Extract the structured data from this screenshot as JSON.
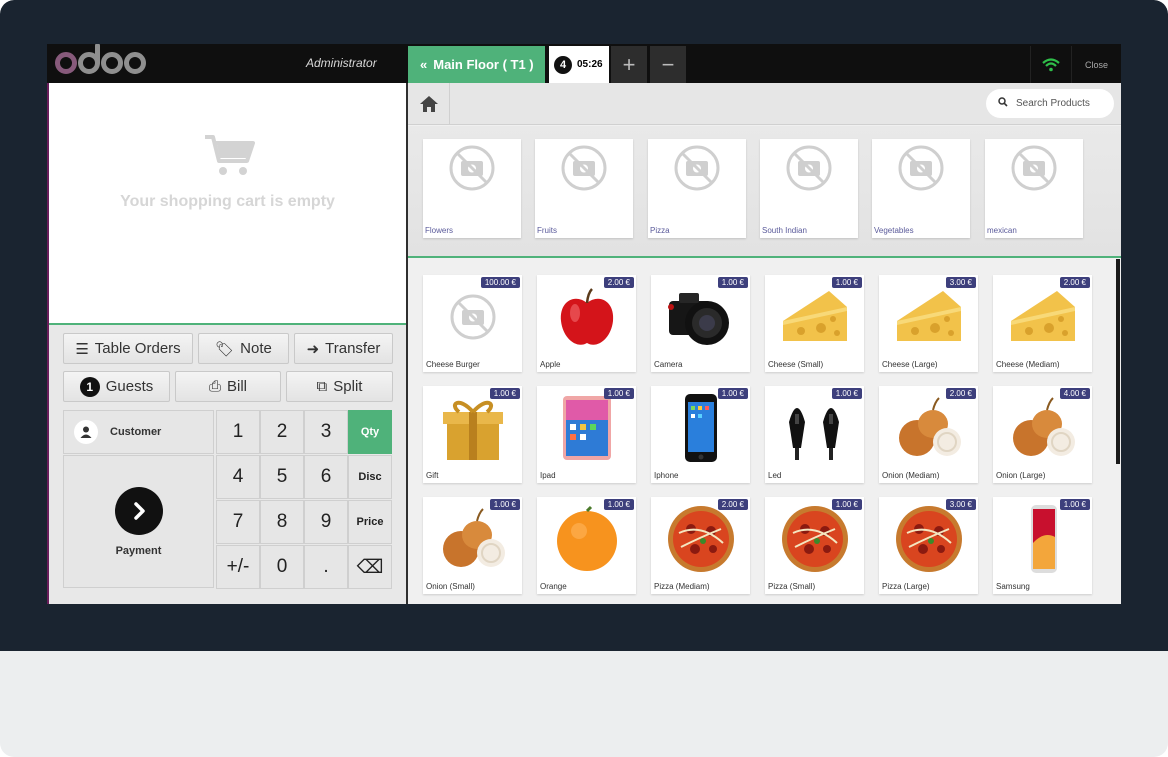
{
  "topbar": {
    "user": "Administrator",
    "floor_tab": "Main Floor ( T1 )",
    "order_number": "4",
    "order_time": "05:26",
    "add_label": "+",
    "remove_label": "−",
    "close_label": "Close"
  },
  "cart": {
    "empty_text": "Your shopping cart is empty"
  },
  "controls": {
    "table_orders": "Table Orders",
    "note": "Note",
    "transfer": "Transfer",
    "guests_count": "1",
    "guests": "Guests",
    "bill": "Bill",
    "split": "Split"
  },
  "numpad": {
    "customer": "Customer",
    "payment": "Payment",
    "keys": [
      "1",
      "2",
      "3",
      "Qty",
      "4",
      "5",
      "6",
      "Disc",
      "7",
      "8",
      "9",
      "Price",
      "+/-",
      "0",
      "."
    ],
    "backspace": "⌫"
  },
  "search": {
    "placeholder": "Search Products"
  },
  "categories": [
    "Flowers",
    "Fruits",
    "Pizza",
    "South Indian",
    "Vegetables",
    "mexican"
  ],
  "products": [
    {
      "name": "Cheese Burger",
      "price": "100.00 €",
      "image": "no-photo"
    },
    {
      "name": "Apple",
      "price": "2.00 €",
      "image": "apple"
    },
    {
      "name": "Camera",
      "price": "1.00 €",
      "image": "camera"
    },
    {
      "name": "Cheese (Small)",
      "price": "1.00 €",
      "image": "cheese"
    },
    {
      "name": "Cheese (Large)",
      "price": "3.00 €",
      "image": "cheese"
    },
    {
      "name": "Cheese (Mediam)",
      "price": "2.00 €",
      "image": "cheese"
    },
    {
      "name": "Gift",
      "price": "1.00 €",
      "image": "gift"
    },
    {
      "name": "Ipad",
      "price": "1.00 €",
      "image": "tablet"
    },
    {
      "name": "Iphone",
      "price": "1.00 €",
      "image": "phone"
    },
    {
      "name": "Led",
      "price": "1.00 €",
      "image": "led"
    },
    {
      "name": "Onion (Mediam)",
      "price": "2.00 €",
      "image": "onion"
    },
    {
      "name": "Onion (Large)",
      "price": "4.00 €",
      "image": "onion"
    },
    {
      "name": "Onion (Small)",
      "price": "1.00 €",
      "image": "onion"
    },
    {
      "name": "Orange",
      "price": "1.00 €",
      "image": "orange"
    },
    {
      "name": "Pizza (Mediam)",
      "price": "2.00 €",
      "image": "pizza"
    },
    {
      "name": "Pizza (Small)",
      "price": "1.00 €",
      "image": "pizza"
    },
    {
      "name": "Pizza (Large)",
      "price": "3.00 €",
      "image": "pizza"
    },
    {
      "name": "Samsung",
      "price": "1.00 €",
      "image": "phone-red"
    }
  ],
  "colors": {
    "accent_green": "#4fb27a",
    "price_badge": "#3d3f7c",
    "brand_purple": "#875a7b"
  }
}
